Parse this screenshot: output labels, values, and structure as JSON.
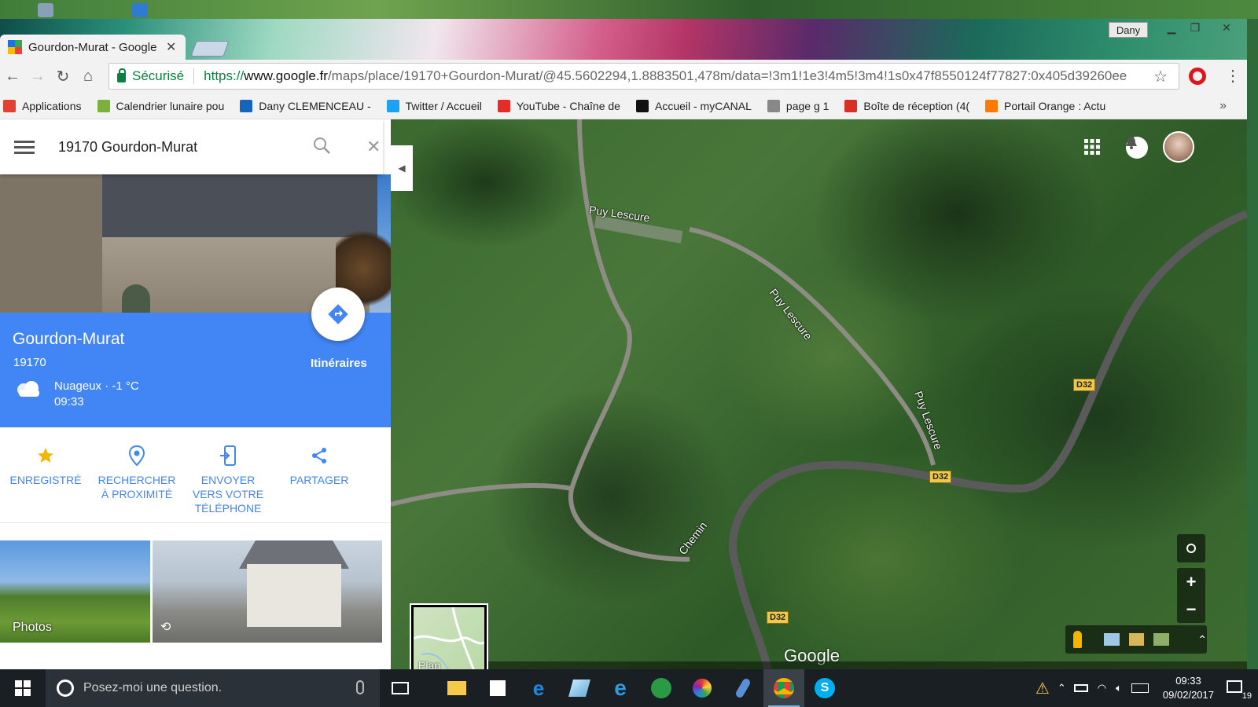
{
  "browser": {
    "tab_title": "Gourdon-Murat - Google Maps",
    "user_badge": "Dany",
    "secure_label": "Sécurisé",
    "url_scheme": "https://",
    "url_host": "www.google.fr",
    "url_path": "/maps/place/19170+Gourdon-Murat/@45.5602294,1.8883501,478m/data=!3m1!1e3!4m5!3m4!1s0x47f8550124f77827:0x405d39260ee"
  },
  "bookmarks": [
    {
      "label": "Applications",
      "icon": "apps-grid-icon",
      "color": "#e34033"
    },
    {
      "label": "Calendrier lunaire pou",
      "icon": "flower-icon",
      "color": "#7bb03a"
    },
    {
      "label": "Dany CLEMENCEAU -",
      "icon": "d-logo-icon",
      "color": "#1565c0"
    },
    {
      "label": "Twitter / Accueil",
      "icon": "twitter-bird-icon",
      "color": "#1da1f2"
    },
    {
      "label": "YouTube - Chaîne de",
      "icon": "youtube-icon",
      "color": "#e52d27"
    },
    {
      "label": "Accueil - myCANAL",
      "icon": "plus-icon",
      "color": "#111111"
    },
    {
      "label": "page g 1",
      "icon": "page-icon",
      "color": "#888888"
    },
    {
      "label": "Boîte de réception (4(",
      "icon": "gmail-icon",
      "color": "#d93025"
    },
    {
      "label": "Portail Orange : Actu",
      "icon": "orange-icon",
      "color": "#ff7900"
    }
  ],
  "search": {
    "query": "19170 Gourdon-Murat"
  },
  "place": {
    "name": "Gourdon-Murat",
    "postal": "19170",
    "weather_line": "Nuageux · -1 °C",
    "weather_time": "09:33",
    "directions_label": "Itinéraires"
  },
  "actions": [
    {
      "label": "ENREGISTRÉ",
      "icon": "star-icon"
    },
    {
      "label": "RECHERCHER À PROXIMITÉ",
      "icon": "nearby-pin-icon"
    },
    {
      "label": "ENVOYER VERS VOTRE TÉLÉPHONE",
      "icon": "send-to-phone-icon"
    },
    {
      "label": "PARTAGER",
      "icon": "share-icon"
    }
  ],
  "photos": {
    "label": "Photos"
  },
  "map": {
    "labels": {
      "puy_lescure_top": "Puy Lescure",
      "puy_lescure_mid": "Puy Lescure",
      "puy_lescure_right": "Puy Lescure",
      "chemin": "Chemin"
    },
    "road_badges": {
      "d32_a": "D32",
      "d32_b": "D32",
      "d32_c": "D32"
    },
    "layer_label": "Plan",
    "logo": "Google"
  },
  "taskbar": {
    "search_placeholder": "Posez-moi une question.",
    "time": "09:33",
    "date": "09/02/2017",
    "notif_count": "19"
  },
  "colors": {
    "accent": "#4285f4",
    "secure": "#0b8043"
  }
}
